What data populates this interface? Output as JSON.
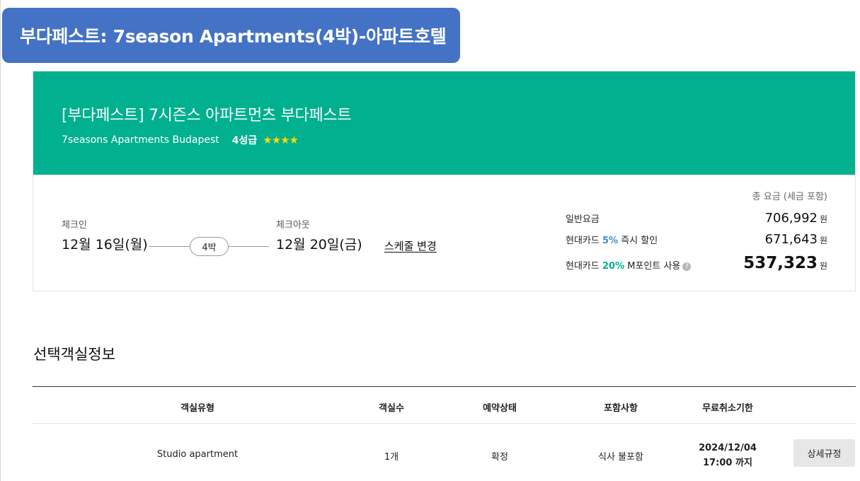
{
  "slide_title": "부다페스트: 7season Apartments(4박)-아파트호텔",
  "hotel": {
    "name_ko": "[부다페스트] 7시즌스 아파트먼츠 부다페스트",
    "name_en": "7seasons Apartments Budapest",
    "grade": "4성급",
    "stars": "★★★★",
    "star_rating": 4,
    "header_color": "#00b08f"
  },
  "stay": {
    "checkin_label": "체크인",
    "checkin_date": "12월 16일(월)",
    "nights": "4박",
    "checkout_label": "체크아웃",
    "checkout_date": "12월 20일(금)",
    "change_schedule": "스케줄 변경"
  },
  "price": {
    "total_note": "총 요금 (세금 포함)",
    "regular_label": "일반요금",
    "regular_amount": "706,992",
    "card_prefix": "현대카드 ",
    "instant_pct": "5%",
    "instant_suffix": " 즉시 할인",
    "instant_amount": "671,643",
    "point_pct": "20%",
    "point_suffix": " M포인트 사용",
    "point_amount": "537,323",
    "currency": "원",
    "help_icon": "?"
  },
  "rooms": {
    "section_title": "선택객실정보",
    "headers": [
      "객실유형",
      "객실수",
      "예약상태",
      "포함사항",
      "무료취소기한"
    ],
    "row": {
      "type": "Studio apartment",
      "count": "1개",
      "status": "확정",
      "included": "식사 불포함",
      "cancel_date": "2024/12/04",
      "cancel_time": "17:00 까지",
      "detail_button": "상세규정"
    }
  }
}
